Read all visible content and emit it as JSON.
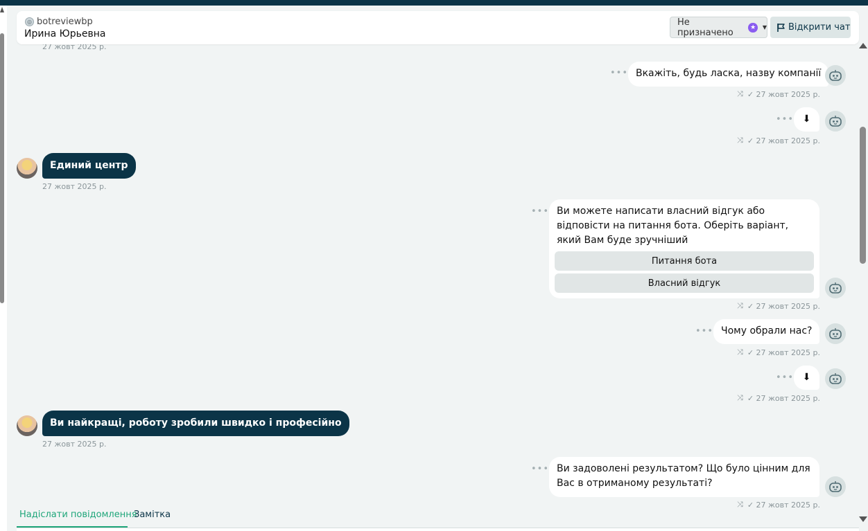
{
  "header": {
    "channel": "botreviewbp",
    "contact_name": "Ирина Юрьевна",
    "assign_label": "Не призначено",
    "open_chat_label": "Відкрити чат"
  },
  "top_partial_ts": "27 жовт 2025 р.",
  "messages": [
    {
      "text": "Вкажіть, будь ласка, назву компанії",
      "ts": "27 жовт 2025 р."
    },
    {
      "text": "⬇",
      "ts": "27 жовт 2025 р."
    },
    {
      "text": "Единий центр",
      "ts": "27 жовт 2025 р."
    },
    {
      "text": "Ви можете написати власний відгук або відповісти на питання бота. Оберіть варіант, який Вам буде зручніший",
      "ts": "27 жовт 2025 р.",
      "buttons": [
        "Питання бота",
        "Власний відгук"
      ]
    },
    {
      "text": "Чому обрали нас?",
      "ts": "27 жовт 2025 р."
    },
    {
      "text": "⬇",
      "ts": "27 жовт 2025 р."
    },
    {
      "text": "Ви найкращі, роботу зробили швидко і професійно",
      "ts": "27 жовт 2025 р."
    },
    {
      "text": "Ви задоволені результатом? Що було цінним для Вас в отриманому результаті?",
      "ts": "27 жовт 2025 р."
    }
  ],
  "tabs": {
    "send_message": "Надіслати повідомлення",
    "note": "Замітка"
  },
  "colors": {
    "accent": "#1fa67a",
    "incoming_bubble": "#0b3447",
    "background": "#f1f4f4"
  }
}
